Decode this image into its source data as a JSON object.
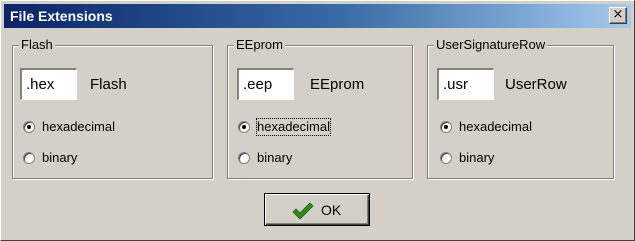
{
  "window": {
    "title": "File Extensions",
    "close_glyph": "×"
  },
  "groups": [
    {
      "legend": "Flash",
      "extension_value": ".hex",
      "caption": "Flash",
      "options": [
        {
          "label": "hexadecimal",
          "selected": true
        },
        {
          "label": "binary",
          "selected": false
        }
      ]
    },
    {
      "legend": "EEprom",
      "extension_value": ".eep",
      "caption": "EEprom",
      "options": [
        {
          "label": "hexadecimal",
          "selected": true,
          "focused": true
        },
        {
          "label": "binary",
          "selected": false
        }
      ]
    },
    {
      "legend": "UserSignatureRow",
      "extension_value": ".usr",
      "caption": "UserRow",
      "options": [
        {
          "label": "hexadecimal",
          "selected": true
        },
        {
          "label": "binary",
          "selected": false
        }
      ]
    }
  ],
  "ok_button": {
    "label": "OK",
    "icon": "checkmark-icon",
    "icon_color": "#2e8b1e"
  },
  "colors": {
    "title_bar_start": "#0a246a",
    "title_bar_end": "#a6caf0",
    "face": "#d4d0c8"
  }
}
